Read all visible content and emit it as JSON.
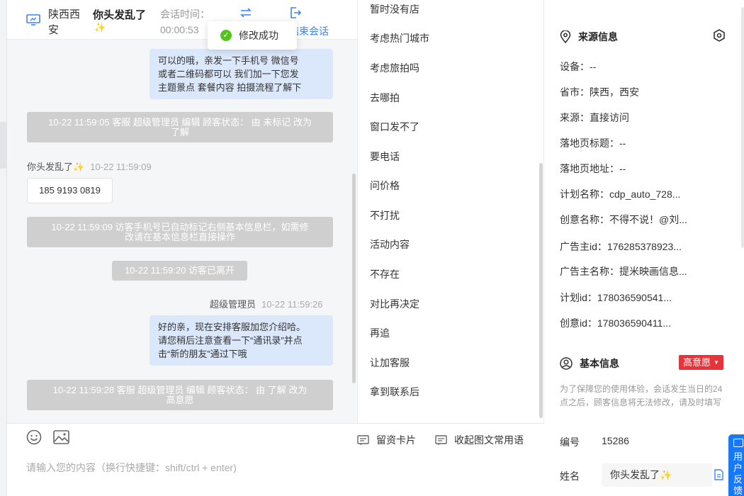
{
  "header": {
    "location_line1": "陕西西",
    "location_line2": "安",
    "visitor_name": "你头发乱了",
    "visitor_emoji": "✨",
    "session_time_label": "会话时间：",
    "session_time_value": "00:00:53",
    "end_session_label": "结束会话"
  },
  "toast": {
    "text": "修改成功"
  },
  "messages": {
    "agent_msg_1": [
      "可以的哦，亲发一下手机号 微信号",
      "或者二维码都可以 我们加一下您发",
      "主题景点 套餐内容 拍摄流程了解下"
    ],
    "sys_1": [
      "10-22 11:59:05 客服 超级管理员 编辑 顾客状态： 由 未标记 改为",
      "了解"
    ],
    "visitor_name": "你头发乱了✨",
    "visitor_time": "10-22 11:59:09",
    "visitor_phone": "185 9193 0819",
    "sys_2": [
      "10-22 11:59:09 访客手机号已自动标记右侧基本信息栏，如需修",
      "改请在基本信息栏直接操作"
    ],
    "sys_3": "10-22 11:59:20 访客已离开",
    "agent_name": "超级管理员",
    "agent_time": "10-22 11:59:26",
    "agent_msg_2": [
      "好的亲，现在安排客服加您介绍哈。",
      "请您稍后注意查看一下“通讯录”并点",
      "击“新的朋友”通过下哦"
    ],
    "sys_4": [
      "10-22 11:59:28 客服 超级管理员 编辑 顾客状态： 由 了解 改为",
      "高意愿"
    ]
  },
  "quick_replies": [
    "暂时没有店",
    "考虑热门城市",
    "考虑旅拍吗",
    "去哪拍",
    "窗口发不了",
    "要电话",
    "问价格",
    "不打扰",
    "活动内容",
    "不存在",
    "对比再决定",
    "再追",
    "让加客服",
    "拿到联系后"
  ],
  "input": {
    "card_label": "留资卡片",
    "fav_label": "收起图文常用语",
    "placeholder": "请输入您的内容（换行快捷键：shift/ctrl + enter)"
  },
  "source_info": {
    "title": "来源信息",
    "rows": [
      "设备：--",
      "省市：陕西，西安",
      "来源：直接访问",
      "落地页标题：--",
      "落地页地址：--",
      "计划名称：cdp_auto_728...",
      "创意名称：不得不说！@刘...",
      "广告主id：176285378923...",
      "广告主名称：提米映画信息...",
      "计划id：178036590541...",
      "创意id：178036590411..."
    ]
  },
  "basic_info": {
    "title": "基本信息",
    "intent_badge": "高意愿",
    "notice": "为了保障您的使用体验，会话发生当日的24点之后，顾客信息将无法修改，请及时填写",
    "id_label": "编号",
    "id_value": "15286",
    "name_label": "姓名",
    "name_value": "你头发乱了✨"
  },
  "feedback_tab": {
    "line1": "用",
    "line2": "户",
    "line3": "反",
    "line4": "馈"
  },
  "colors": {
    "accent": "#3b82f6",
    "badge": "#e5353a",
    "agent_bubble": "#dbe7fb",
    "system_msg": "#cfcfcf"
  }
}
